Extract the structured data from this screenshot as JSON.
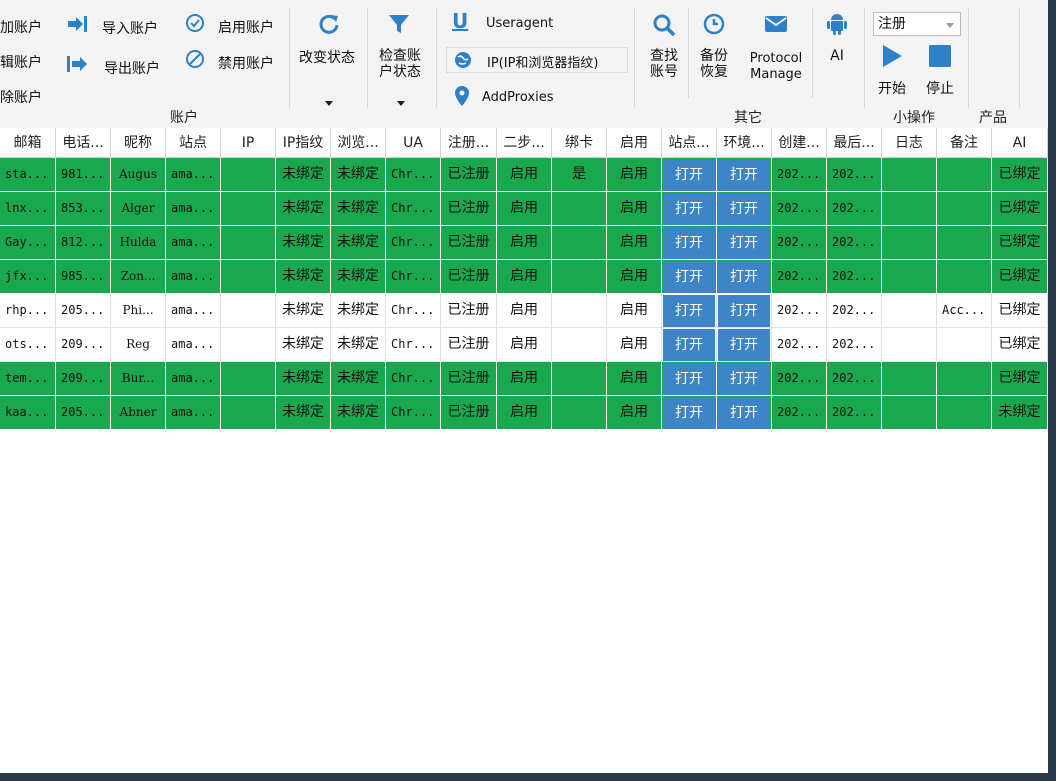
{
  "toolbar": {
    "account_group": {
      "label": "账户",
      "add": "加账户",
      "edit": "辑账户",
      "delete": "除账户",
      "import": "导入账户",
      "export": "导出账户",
      "enable": "启用账户",
      "disable": "禁用账户"
    },
    "change_status": "改变状态",
    "check_status_line1": "检查账",
    "check_status_line2": "户状态",
    "useragent": "Useragent",
    "ip_fingerprint": "IP(IP和浏览器指纹)",
    "add_proxies": "AddProxies",
    "find_line1": "查找",
    "find_line2": "账号",
    "backup_line1": "备份",
    "backup_line2": "恢复",
    "protocol_line1": "Protocol",
    "protocol_line2": "Manage",
    "ai": "AI",
    "other_group_label": "其它",
    "status_select": "注册",
    "start": "开始",
    "stop": "停止",
    "small_ops_label": "小操作",
    "product_label": "产品"
  },
  "table": {
    "columns": [
      "邮箱",
      "电话...",
      "昵称",
      "站点",
      "IP",
      "IP指纹",
      "浏览...",
      "UA",
      "注册...",
      "二步...",
      "绑卡",
      "启用",
      "站点...",
      "环境...",
      "创建...",
      "最后...",
      "日志",
      "备注",
      "AI"
    ],
    "rows": [
      {
        "style": "green",
        "cells": [
          "sta...",
          "981...",
          "Augus",
          "ama...",
          "",
          "未绑定",
          "未绑定",
          "Chr...",
          "已注册",
          "启用",
          "是",
          "启用",
          "打开",
          "打开",
          "202...",
          "202...",
          "",
          "",
          "已绑定"
        ]
      },
      {
        "style": "green",
        "cells": [
          "lnx...",
          "853...",
          "Alger",
          "ama...",
          "",
          "未绑定",
          "未绑定",
          "Chr...",
          "已注册",
          "启用",
          "",
          "启用",
          "打开",
          "打开",
          "202...",
          "202...",
          "",
          "",
          "已绑定"
        ]
      },
      {
        "style": "green",
        "cells": [
          "Gay...",
          "812...",
          "Hulda",
          "ama...",
          "",
          "未绑定",
          "未绑定",
          "Chr...",
          "已注册",
          "启用",
          "",
          "启用",
          "打开",
          "打开",
          "202...",
          "202...",
          "",
          "",
          "已绑定"
        ]
      },
      {
        "style": "green",
        "cells": [
          "jfx...",
          "985...",
          "Zon...",
          "ama...",
          "",
          "未绑定",
          "未绑定",
          "Chr...",
          "已注册",
          "启用",
          "",
          "启用",
          "打开",
          "打开",
          "202...",
          "202...",
          "",
          "",
          "已绑定"
        ]
      },
      {
        "style": "white",
        "cells": [
          "rhp...",
          "205...",
          "Phi...",
          "ama...",
          "",
          "未绑定",
          "未绑定",
          "Chr...",
          "已注册",
          "启用",
          "",
          "启用",
          "打开",
          "打开",
          "202...",
          "202...",
          "",
          "Acc...",
          "已绑定"
        ]
      },
      {
        "style": "white",
        "cells": [
          "ots...",
          "209...",
          "Reg",
          "ama...",
          "",
          "未绑定",
          "未绑定",
          "Chr...",
          "已注册",
          "启用",
          "",
          "启用",
          "打开",
          "打开",
          "202...",
          "202...",
          "",
          "",
          "已绑定"
        ]
      },
      {
        "style": "green",
        "cells": [
          "tem...",
          "209...",
          "Bur...",
          "ama...",
          "",
          "未绑定",
          "未绑定",
          "Chr...",
          "已注册",
          "启用",
          "",
          "启用",
          "打开",
          "打开",
          "202...",
          "202...",
          "",
          "",
          "已绑定"
        ]
      },
      {
        "style": "green",
        "cells": [
          "kaa...",
          "205...",
          "Abner",
          "ama...",
          "",
          "未绑定",
          "未绑定",
          "Chr...",
          "已注册",
          "启用",
          "",
          "启用",
          "打开",
          "打开",
          "202...",
          "202...",
          "",
          "",
          "未绑定"
        ]
      }
    ]
  },
  "colors": {
    "row_green": "#1aa84e",
    "open_button": "#3d85c6",
    "icon_blue": "#2f80c8"
  }
}
